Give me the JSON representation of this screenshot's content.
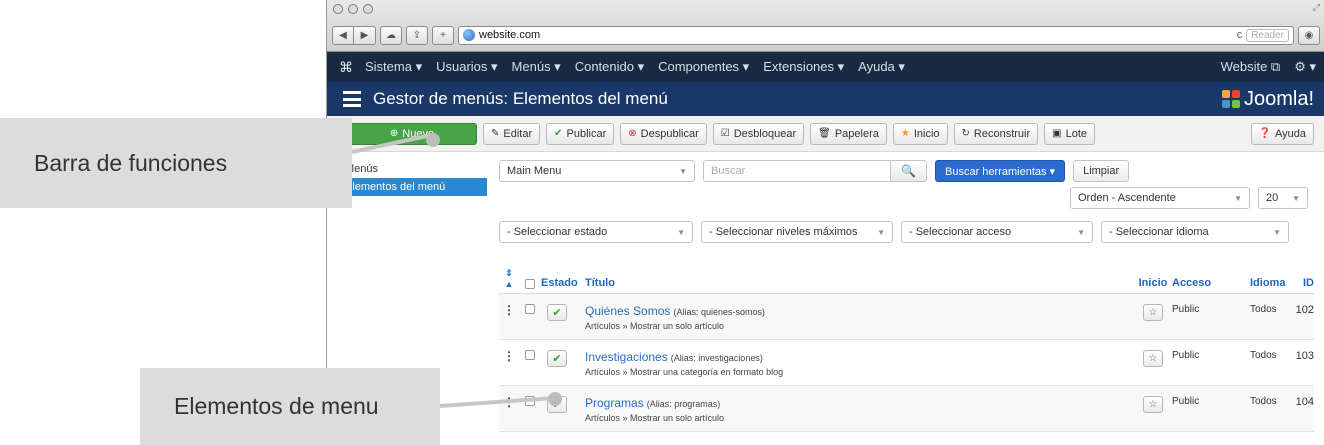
{
  "browser": {
    "url": "website.com",
    "reader_label": "Reader",
    "reload_glyph": "c"
  },
  "topnav": {
    "items": [
      "Sistema ▾",
      "Usuarios ▾",
      "Menús ▾",
      "Contenido ▾",
      "Componentes ▾",
      "Extensiones ▾",
      "Ayuda ▾"
    ],
    "site_link": "Website ⧉",
    "gear": "⚙ ▾"
  },
  "header": {
    "title": "Gestor de menús: Elementos del menú",
    "brand": "Joomla!"
  },
  "toolbar": {
    "new": "Nuevo",
    "edit": "Editar",
    "publish": "Publicar",
    "unpublish": "Despublicar",
    "checkin": "Desbloquear",
    "trash": "Papelera",
    "home": "Inicio",
    "rebuild": "Reconstruir",
    "batch": "Lote",
    "help": "Ayuda"
  },
  "sidebar": {
    "items": [
      {
        "label": "Menús"
      },
      {
        "label": "Elementos del menú"
      }
    ]
  },
  "filters": {
    "menu": "Main Menu",
    "search_placeholder": "Buscar",
    "search_tools": "Buscar herramientas ▾",
    "clear": "Limpiar",
    "ordering": "Orden - Ascendente",
    "limit": "20",
    "state": "- Seleccionar estado",
    "levels": "- Seleccionar niveles máximos",
    "access": "- Seleccionar acceso",
    "language": "- Seleccionar idioma"
  },
  "table": {
    "headers": {
      "state": "Estado",
      "title": "Título",
      "home": "Inicio",
      "access": "Acceso",
      "language": "Idioma",
      "id": "ID"
    },
    "rows": [
      {
        "title": "Quiénes Somos",
        "alias": "(Alias: quienes-somos)",
        "type": "Artículos » Mostrar un solo artículo",
        "access": "Public",
        "language": "Todos",
        "id": "102"
      },
      {
        "title": "Investigaciones",
        "alias": "(Alias: investigaciones)",
        "type": "Artículos » Mostrar una categoría en formato blog",
        "access": "Public",
        "language": "Todos",
        "id": "103"
      },
      {
        "title": "Programas",
        "alias": "(Alias: programas)",
        "type": "Artículos » Mostrar un solo artículo",
        "access": "Public",
        "language": "Todos",
        "id": "104"
      }
    ]
  },
  "callouts": {
    "toolbar_label": "Barra de funciones",
    "items_label": "Elementos de menu"
  },
  "colors": {
    "navbar": "#172a42",
    "header": "#1a3867",
    "new_button": "#47a447",
    "accent_blue": "#2b6bcf",
    "callout_bg": "#dcdcdc"
  }
}
